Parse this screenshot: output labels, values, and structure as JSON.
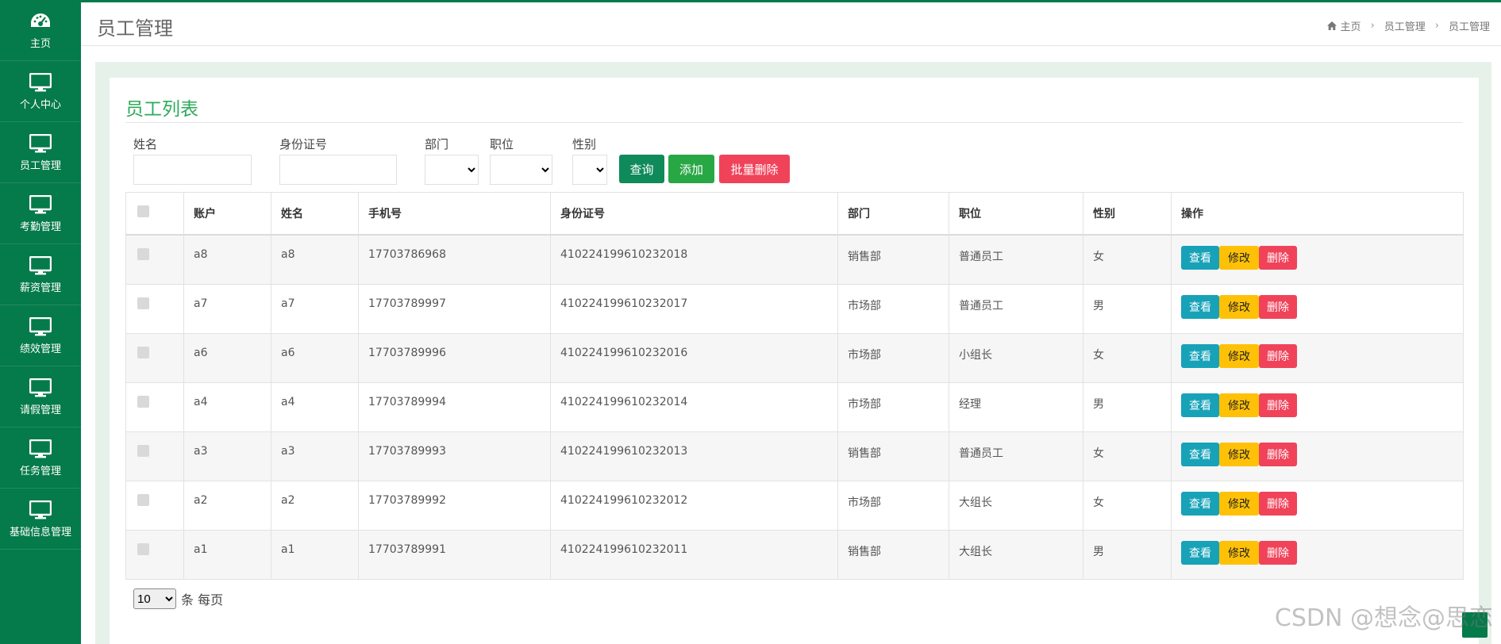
{
  "sidebar": {
    "items": [
      {
        "label": "主页",
        "icon": "dashboard-icon"
      },
      {
        "label": "个人中心",
        "icon": "monitor-icon"
      },
      {
        "label": "员工管理",
        "icon": "monitor-icon"
      },
      {
        "label": "考勤管理",
        "icon": "monitor-icon"
      },
      {
        "label": "薪资管理",
        "icon": "monitor-icon"
      },
      {
        "label": "绩效管理",
        "icon": "monitor-icon"
      },
      {
        "label": "请假管理",
        "icon": "monitor-icon"
      },
      {
        "label": "任务管理",
        "icon": "monitor-icon"
      },
      {
        "label": "基础信息管理",
        "icon": "monitor-icon"
      }
    ]
  },
  "header": {
    "title": "员工管理",
    "breadcrumb": [
      "主页",
      "员工管理",
      "员工管理"
    ]
  },
  "panel": {
    "title": "员工列表"
  },
  "search": {
    "name_label": "姓名",
    "name_value": "",
    "idcard_label": "身份证号",
    "idcard_value": "",
    "dept_label": "部门",
    "dept_value": "",
    "position_label": "职位",
    "position_value": "",
    "gender_label": "性别",
    "gender_value": "",
    "query_label": "查询",
    "add_label": "添加",
    "batch_delete_label": "批量删除"
  },
  "table": {
    "headers": [
      "账户",
      "姓名",
      "手机号",
      "身份证号",
      "部门",
      "职位",
      "性别",
      "操作"
    ],
    "rows": [
      {
        "account": "a8",
        "name": "a8",
        "phone": "17703786968",
        "idcard": "410224199610232018",
        "dept": "销售部",
        "position": "普通员工",
        "gender": "女"
      },
      {
        "account": "a7",
        "name": "a7",
        "phone": "17703789997",
        "idcard": "410224199610232017",
        "dept": "市场部",
        "position": "普通员工",
        "gender": "男"
      },
      {
        "account": "a6",
        "name": "a6",
        "phone": "17703789996",
        "idcard": "410224199610232016",
        "dept": "市场部",
        "position": "小组长",
        "gender": "女"
      },
      {
        "account": "a4",
        "name": "a4",
        "phone": "17703789994",
        "idcard": "410224199610232014",
        "dept": "市场部",
        "position": "经理",
        "gender": "男"
      },
      {
        "account": "a3",
        "name": "a3",
        "phone": "17703789993",
        "idcard": "410224199610232013",
        "dept": "销售部",
        "position": "普通员工",
        "gender": "女"
      },
      {
        "account": "a2",
        "name": "a2",
        "phone": "17703789992",
        "idcard": "410224199610232012",
        "dept": "市场部",
        "position": "大组长",
        "gender": "女"
      },
      {
        "account": "a1",
        "name": "a1",
        "phone": "17703789991",
        "idcard": "410224199610232011",
        "dept": "销售部",
        "position": "大组长",
        "gender": "男"
      }
    ],
    "actions": {
      "view": "查看",
      "edit": "修改",
      "delete": "删除"
    }
  },
  "pagination": {
    "page_size": "10",
    "suffix": "条 每页"
  },
  "watermark": "CSDN @想念@思恋",
  "colors": {
    "sidebar": "#057a4a",
    "accent_title": "#2eaa5a",
    "query_btn": "#0f8a5a",
    "add_btn": "#28a745",
    "danger_btn": "#f0435a",
    "view_btn": "#17a2b8",
    "edit_btn": "#ffc107"
  }
}
